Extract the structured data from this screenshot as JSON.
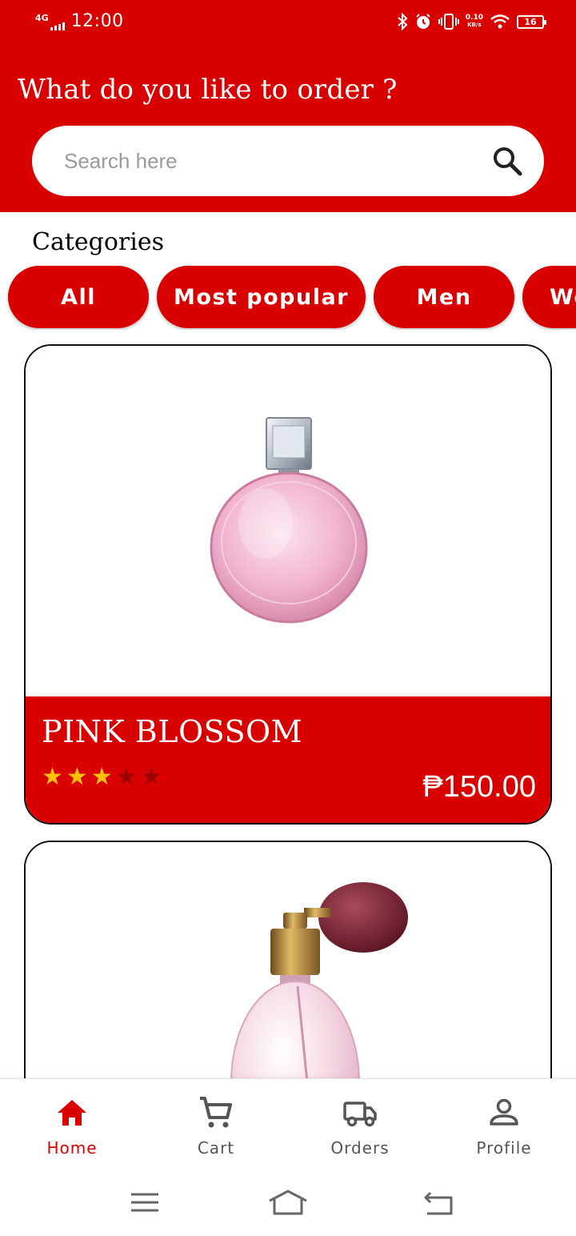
{
  "colors": {
    "brand": "#d90000",
    "star_on": "#ffc107",
    "star_off": "#9e0000",
    "nav_inactive": "#555555"
  },
  "status_bar": {
    "network": "4G",
    "time": "12:00",
    "speed_value": "0.10",
    "speed_unit": "KB/s",
    "battery": "16"
  },
  "header": {
    "title": "What do you like to order ?"
  },
  "search": {
    "placeholder": "Search here",
    "value": "",
    "icon": "search-icon"
  },
  "categories": {
    "title": "Categories",
    "chips": [
      {
        "label": "All"
      },
      {
        "label": "Most popular"
      },
      {
        "label": "Men"
      },
      {
        "label": "Women"
      }
    ]
  },
  "products": [
    {
      "name": "PINK BLOSSOM",
      "rating": 3,
      "rating_max": 5,
      "price": "₱150.00"
    },
    {
      "name": "",
      "rating": null,
      "price": ""
    }
  ],
  "bottom_nav": {
    "items": [
      {
        "label": "Home",
        "icon": "home-icon",
        "active": true
      },
      {
        "label": "Cart",
        "icon": "cart-icon",
        "active": false
      },
      {
        "label": "Orders",
        "icon": "truck-icon",
        "active": false
      },
      {
        "label": "Profile",
        "icon": "person-icon",
        "active": false
      }
    ]
  },
  "system_nav": [
    "menu-icon",
    "home-outline-icon",
    "back-icon"
  ]
}
